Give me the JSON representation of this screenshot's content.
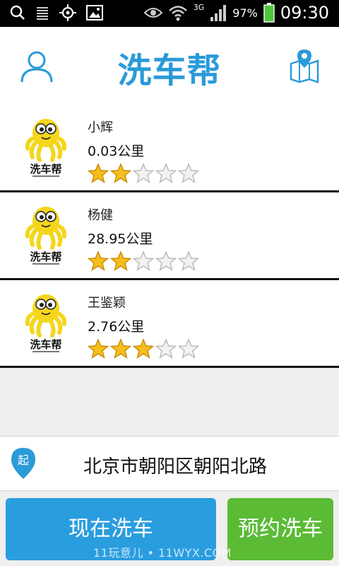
{
  "statusbar": {
    "network": "3G",
    "battery": "97%",
    "time": "09:30",
    "icons": [
      "search-icon",
      "menu-lines-icon",
      "crosshair-icon",
      "image-icon",
      "eye-icon",
      "wifi-icon",
      "signal-icon",
      "battery-icon"
    ]
  },
  "header": {
    "title": "洗车帮"
  },
  "list": [
    {
      "name": "小辉",
      "distance": "0.03公里",
      "rating": 2,
      "max": 5
    },
    {
      "name": "杨健",
      "distance": "28.95公里",
      "rating": 2,
      "max": 5
    },
    {
      "name": "王鉴颖",
      "distance": "2.76公里",
      "rating": 3,
      "max": 5
    }
  ],
  "avatar_logo_text": "洗车帮",
  "address": {
    "pin_label": "起",
    "text": "北京市朝阳区朝阳北路"
  },
  "actions": {
    "wash_now": "现在洗车",
    "reserve": "预约洗车"
  },
  "watermark": "11玩意儿 • 11WYX.COM",
  "colors": {
    "brand_blue": "#2b9ad8",
    "button_blue": "#2a9ddf",
    "button_green": "#5bbb35",
    "star_gold": "#f6be1c"
  }
}
